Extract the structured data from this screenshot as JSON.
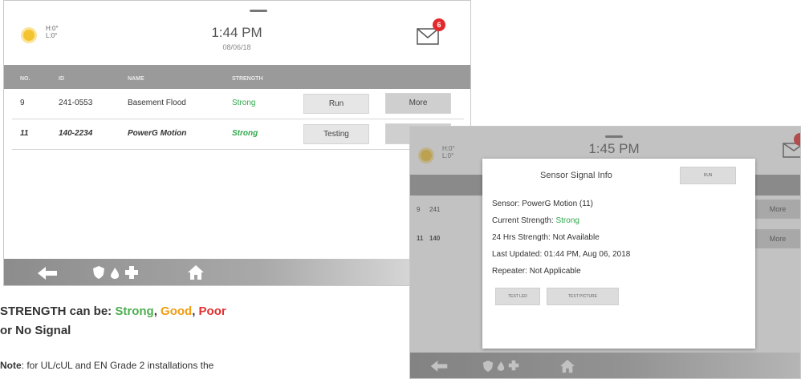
{
  "panel1": {
    "weather": {
      "hi": "H:0°",
      "lo": "L:0°"
    },
    "time": "1:44 PM",
    "date": "08/06/18",
    "mail_badge": "6",
    "table": {
      "headers": [
        "NO.",
        "ID",
        "NAME",
        "STRENGTH"
      ],
      "rows": [
        {
          "no": "9",
          "id": "241-0553",
          "name": "Basement Flood",
          "strength": "Strong",
          "action": "Run",
          "more": "More"
        },
        {
          "no": "11",
          "id": "140-2234",
          "name": "PowerG Motion",
          "strength": "Strong",
          "action": "Testing",
          "more": ""
        }
      ]
    }
  },
  "panel2": {
    "weather": {
      "hi": "H:0°",
      "lo": "L:0°"
    },
    "time": "1:45 PM",
    "background_rows": [
      {
        "no": "9",
        "id": "241",
        "more": "More"
      },
      {
        "no": "11",
        "id": "140",
        "more": "More"
      }
    ],
    "dialog": {
      "title": "Sensor Signal Info",
      "run_label": "RUN",
      "sensor": "Sensor: PowerG Motion (11)",
      "current_label": "Current Strength: ",
      "current_value": "Strong",
      "hrs24": "24 Hrs Strength: Not Available",
      "updated": "Last Updated: 01:44 PM, Aug 06, 2018",
      "repeater": "Repeater: Not Applicable",
      "test_led": "TEST LED",
      "test_picture": "TEST PICTURE"
    }
  },
  "caption": {
    "prefix": "STRENGTH can be: ",
    "strong": "Strong",
    "sep1": ", ",
    "good": "Good",
    "sep2": ", ",
    "poor": "Poor",
    "line2": "or No Signal",
    "note_bold": "Note",
    "note_text": ": for UL/cUL and EN Grade 2 installations the"
  },
  "colors": {
    "strong": "#2ea84a",
    "good": "#f39c12",
    "poor": "#e3302f",
    "badge": "#e2282a"
  }
}
